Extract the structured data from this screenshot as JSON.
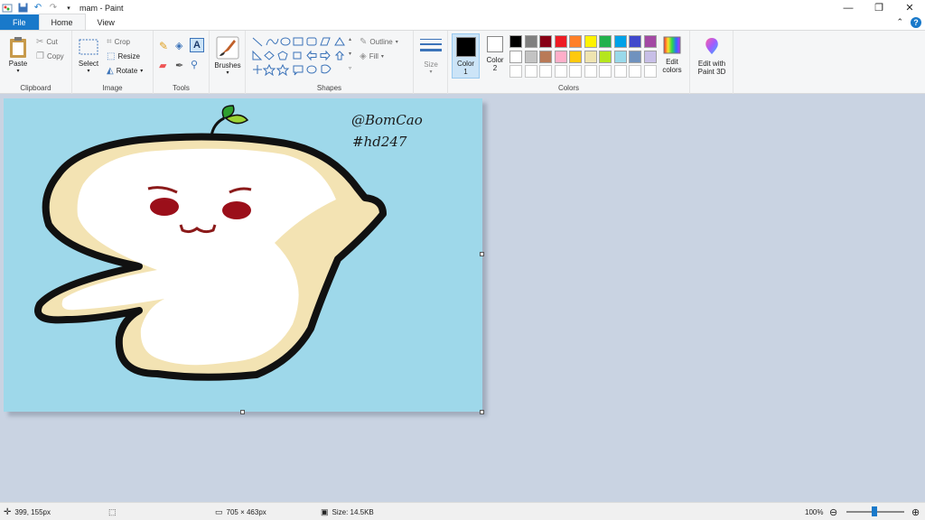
{
  "window": {
    "title": "mam - Paint",
    "controls": {
      "minimize": "—",
      "maximize": "❐",
      "close": "✕"
    }
  },
  "tabs": {
    "file": "File",
    "home": "Home",
    "view": "View"
  },
  "ribbon": {
    "clipboard": {
      "label": "Clipboard",
      "paste": "Paste",
      "cut": "Cut",
      "copy": "Copy"
    },
    "image": {
      "label": "Image",
      "select": "Select",
      "crop": "Crop",
      "resize": "Resize",
      "rotate": "Rotate"
    },
    "tools": {
      "label": "Tools"
    },
    "brushes": {
      "label": "Brushes"
    },
    "shapes": {
      "label": "Shapes",
      "outline": "Outline",
      "fill": "Fill"
    },
    "size": {
      "label": "Size"
    },
    "colors": {
      "label": "Colors",
      "color1": {
        "label1": "Color",
        "label2": "1",
        "value": "#000000"
      },
      "color2": {
        "label1": "Color",
        "label2": "2",
        "value": "#ffffff"
      },
      "palette_row1": [
        "#000000",
        "#7f7f7f",
        "#880015",
        "#ed1c24",
        "#ff7f27",
        "#fff200",
        "#22b14c",
        "#00a2e8",
        "#3f48cc",
        "#a349a4"
      ],
      "palette_row2": [
        "#ffffff",
        "#c3c3c3",
        "#b97a57",
        "#ffaec9",
        "#ffc90e",
        "#efe4b0",
        "#b5e61d",
        "#99d9ea",
        "#7092be",
        "#c8bfe7"
      ],
      "palette_row3": [
        "#ffffff",
        "#ffffff",
        "#ffffff",
        "#ffffff",
        "#ffffff",
        "#ffffff",
        "#ffffff",
        "#ffffff",
        "#ffffff",
        "#ffffff"
      ],
      "edit_colors": {
        "line1": "Edit",
        "line2": "colors"
      }
    },
    "paint3d": {
      "line1": "Edit with",
      "line2": "Paint 3D"
    }
  },
  "canvas": {
    "background": "#9ed8ea",
    "signature1": "@BomCao",
    "signature2": "#hd247"
  },
  "status": {
    "cursor": "399, 155px",
    "dimensions": "705 × 463px",
    "size": "Size: 14.5KB",
    "zoom": "100%",
    "zoom_out": "⊖",
    "zoom_in": "⊕"
  }
}
